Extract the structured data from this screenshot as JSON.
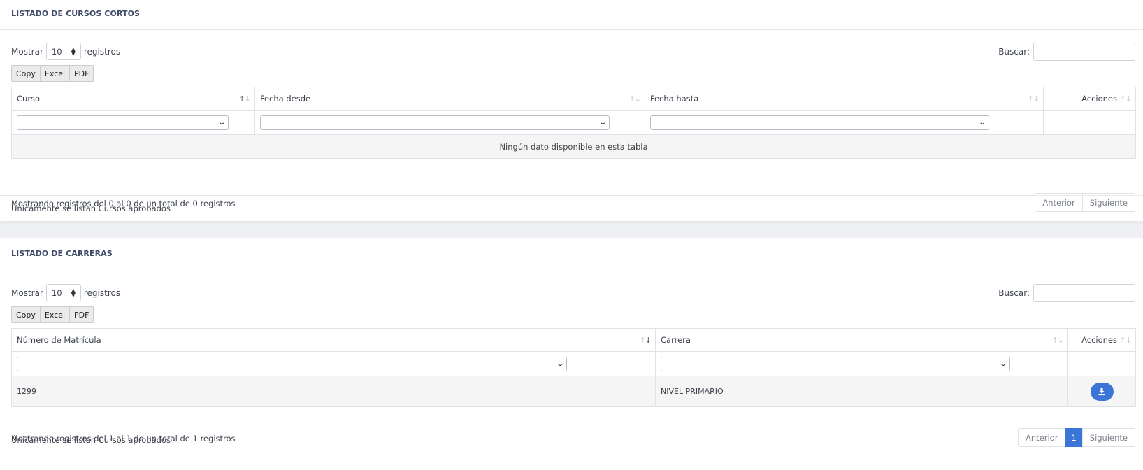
{
  "cursos": {
    "title": "LISTADO DE CURSOS CORTOS",
    "length_prefix": "Mostrar",
    "length_value": "10",
    "length_suffix": "registros",
    "search_label": "Buscar:",
    "buttons": [
      "Copy",
      "Excel",
      "PDF"
    ],
    "columns": [
      "Curso",
      "Fecha desde",
      "Fecha hasta",
      "Acciones"
    ],
    "empty_text": "Ningún dato disponible en esta tabla",
    "info": "Mostrando registros del 0 al 0 de un total de 0 registros",
    "prev": "Anterior",
    "next": "Siguiente",
    "footer": "Únicamente se listan Cursos aprobados"
  },
  "carreras": {
    "title": "LISTADO DE CARRERAS",
    "length_prefix": "Mostrar",
    "length_value": "10",
    "length_suffix": "registros",
    "search_label": "Buscar:",
    "buttons": [
      "Copy",
      "Excel",
      "PDF"
    ],
    "columns": [
      "Número de Matrícula",
      "Carrera",
      "Acciones"
    ],
    "rows": [
      {
        "matricula": "1299",
        "carrera": "NIVEL PRIMARIO"
      }
    ],
    "info": "Mostrando registros del 1 al 1 de un total de 1 registros",
    "prev": "Anterior",
    "page": "1",
    "next": "Siguiente",
    "footer": "Únicamente se listan Cursos aprobados"
  },
  "icons": {
    "length_select": "up-down-arrows-icon",
    "filter_select": "chevron-down-icon",
    "sort": "sort-arrows-icon",
    "download": "download-icon"
  },
  "colors": {
    "accent": "#3b76d6",
    "title": "#3f4a66"
  }
}
